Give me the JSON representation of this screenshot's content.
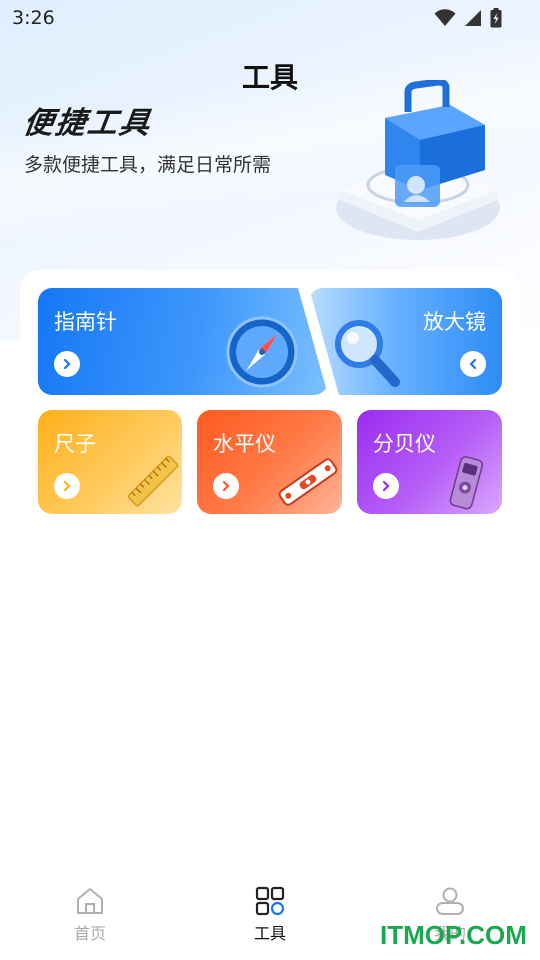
{
  "status": {
    "time": "3:26"
  },
  "page": {
    "title": "工具"
  },
  "hero": {
    "title": "便捷工具",
    "subtitle": "多款便捷工具，满足日常所需"
  },
  "tools": {
    "compass": "指南针",
    "magnifier": "放大镜",
    "ruler": "尺子",
    "level": "水平仪",
    "decibel": "分贝仪"
  },
  "tabbar": {
    "home": "首页",
    "tools": "工具",
    "mine": "我的"
  },
  "watermark": "ITMOP.COM",
  "colors": {
    "accent": "#1677f5",
    "ruler": "#ffb01a",
    "level": "#ff5a1f",
    "decibel": "#9b2cf0",
    "watermark": "#1aa84f"
  }
}
